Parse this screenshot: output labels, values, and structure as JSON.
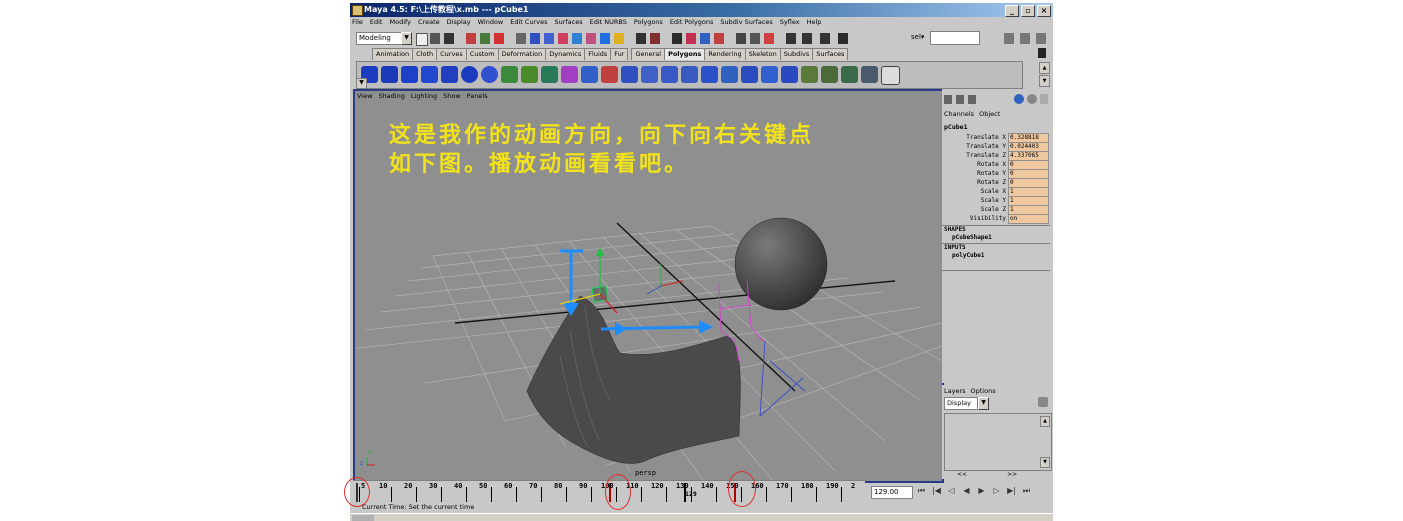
{
  "window": {
    "title": "Maya 4.5: F:\\上传教程\\x.mb  ---  pCube1",
    "min_label": "_",
    "max_label": "&#9633;",
    "close_label": "×"
  },
  "menubar": [
    "File",
    "Edit",
    "Modify",
    "Create",
    "Display",
    "Window",
    "Edit Curves",
    "Surfaces",
    "Edit NURBS",
    "Polygons",
    "Edit Polygons",
    "Subdiv Surfaces",
    "Syflex",
    "Help"
  ],
  "status_line": {
    "mode": "Modeling",
    "sel_label": "sel▾"
  },
  "shelf_tabs": [
    "Animation",
    "Cloth",
    "Curves",
    "Custom",
    "Deformation",
    "Dynamics",
    "Fluids",
    "Fur",
    "General",
    "Polygons",
    "Rendering",
    "Skeleton",
    "Subdivs",
    "Surfaces"
  ],
  "shelf_active": "Polygons",
  "viewport": {
    "menu": [
      "View",
      "Shading",
      "Lighting",
      "Show",
      "Panels"
    ],
    "overlay_line1": "这是我作的动画方向，向下向右关键点",
    "overlay_line2": "如下图。播放动画看看吧。",
    "camera_label": "persp",
    "axis_y": "y",
    "axis_z": "z"
  },
  "channel_box": {
    "tabs": [
      "Channels",
      "Object"
    ],
    "object": "pCube1",
    "attributes": [
      {
        "name": "Translate X",
        "value": "0.328818"
      },
      {
        "name": "Translate Y",
        "value": "0.024403"
      },
      {
        "name": "Translate Z",
        "value": "4.337065"
      },
      {
        "name": "Rotate X",
        "value": "0"
      },
      {
        "name": "Rotate Y",
        "value": "0"
      },
      {
        "name": "Rotate Z",
        "value": "0"
      },
      {
        "name": "Scale X",
        "value": "1"
      },
      {
        "name": "Scale Y",
        "value": "1"
      },
      {
        "name": "Scale Z",
        "value": "1"
      },
      {
        "name": "Visibility",
        "value": "on"
      }
    ],
    "shapes_label": "SHAPES",
    "shape_name": "pCubeShape1",
    "inputs_label": "INPUTS",
    "input_name": "polyCube1"
  },
  "layers": {
    "tabs": [
      "Layers",
      "Options"
    ],
    "display": "Display",
    "scroll_left": "<<",
    "scroll_right": ">>"
  },
  "timeline": {
    "labels": [
      "5",
      "10",
      "20",
      "30",
      "40",
      "50",
      "60",
      "70",
      "80",
      "90",
      "100",
      "110",
      "120",
      "130",
      "140",
      "150",
      "160",
      "170",
      "180",
      "190",
      "2"
    ],
    "current_frame_marker": "129",
    "current_time": "129.00"
  },
  "help_line": "Current Time: Set the current time",
  "colors": {
    "overlay_text": "#f2e21c",
    "viewport_bg": "#8f8f8f",
    "attr_value_bg": "#f0c8a0",
    "annotation_circle": "#e03030"
  }
}
